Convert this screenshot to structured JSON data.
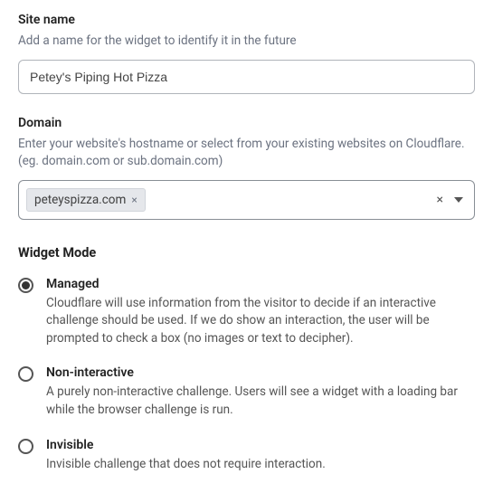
{
  "site_name": {
    "label": "Site name",
    "help": "Add a name for the widget to identify it in the future",
    "value": "Petey's Piping Hot Pizza"
  },
  "domain": {
    "label": "Domain",
    "help": "Enter your website's hostname or select from your existing websites on Cloudflare. (eg. domain.com or sub.domain.com)",
    "chip": "peteyspizza.com"
  },
  "widget_mode": {
    "title": "Widget Mode",
    "options": [
      {
        "label": "Managed",
        "desc": "Cloudflare will use information from the visitor to decide if an interactive challenge should be used. If we do show an interaction, the user will be prompted to check a box (no images or text to decipher).",
        "selected": true
      },
      {
        "label": "Non-interactive",
        "desc": "A purely non-interactive challenge. Users will see a widget with a loading bar while the browser challenge is run.",
        "selected": false
      },
      {
        "label": "Invisible",
        "desc": "Invisible challenge that does not require interaction.",
        "selected": false
      }
    ]
  }
}
